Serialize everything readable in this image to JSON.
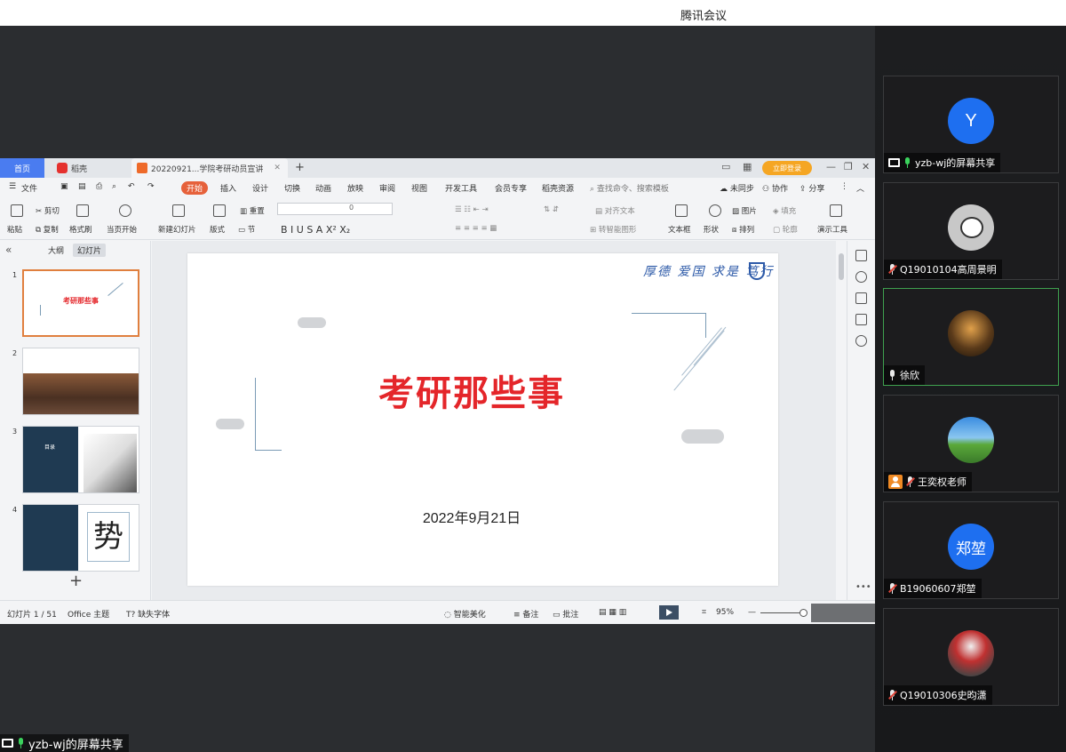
{
  "meeting": {
    "app_title": "腾讯会议"
  },
  "participants": [
    {
      "name": "yzb-wj的屏幕共享",
      "avatar": "Y",
      "avatar_type": "letter",
      "avatar_color": "#1e6ff0",
      "mic": "on",
      "sharing": true
    },
    {
      "name": "Q19010104高周景明",
      "avatar_type": "photo-snoopy",
      "mic": "muted"
    },
    {
      "name": "徐欣",
      "avatar_type": "photo-street",
      "mic": "on",
      "speaking": true
    },
    {
      "name": "王奕权老师",
      "avatar_type": "photo-field",
      "mic": "muted",
      "host": true
    },
    {
      "name": "B19060607郑堃",
      "avatar": "郑堃",
      "avatar_type": "letter",
      "avatar_color": "#1e6ff0",
      "mic": "muted"
    },
    {
      "name": "Q19010306史昀潇",
      "avatar_type": "photo-clown",
      "mic": "muted"
    }
  ],
  "wps": {
    "tabs": {
      "home": "首页",
      "docer": "稻壳",
      "doc": "20220921...学院考研动员宣讲"
    },
    "login": "立即登录",
    "menu": [
      "文件",
      "开始",
      "插入",
      "设计",
      "切换",
      "动画",
      "放映",
      "审阅",
      "视图",
      "开发工具",
      "会员专享",
      "稻壳资源"
    ],
    "search_placeholder": "查找命令、搜索模板",
    "menu_right": {
      "sync": "未同步",
      "collab": "协作",
      "share": "分享"
    },
    "ribbon": {
      "cut": "剪切",
      "paste": "粘贴",
      "copy": "复制",
      "format": "格式刷",
      "from_first": "当页开始",
      "new_slide": "新建幻灯片",
      "layout": "版式",
      "section": "节",
      "reset": "重置",
      "font_size": "0",
      "align_text": "对齐文本",
      "smart_art": "转智能图形",
      "textbox": "文本框",
      "shape": "形状",
      "picture": "图片",
      "arrange": "排列",
      "fill": "填充",
      "outline": "轮廓",
      "present_tools": "演示工具"
    },
    "outline_tabs": {
      "outline": "大纲",
      "slides": "幻灯片"
    },
    "thumbnails": [
      {
        "num": "1",
        "title": "考研那些事"
      },
      {
        "num": "2"
      },
      {
        "num": "3",
        "text": "目录"
      },
      {
        "num": "4",
        "text": "势"
      }
    ],
    "slide": {
      "title": "考研那些事",
      "date": "2022年9月21日",
      "motto": "厚德 爱国 求是 笃行"
    },
    "status": {
      "slide_counter": "幻灯片 1 / 51",
      "theme": "Office 主题",
      "missing_font": "缺失字体",
      "beautify": "智能美化",
      "notes": "备注",
      "comments": "批注",
      "zoom": "95%"
    }
  },
  "sharing_label": "yzb-wj的屏幕共享"
}
